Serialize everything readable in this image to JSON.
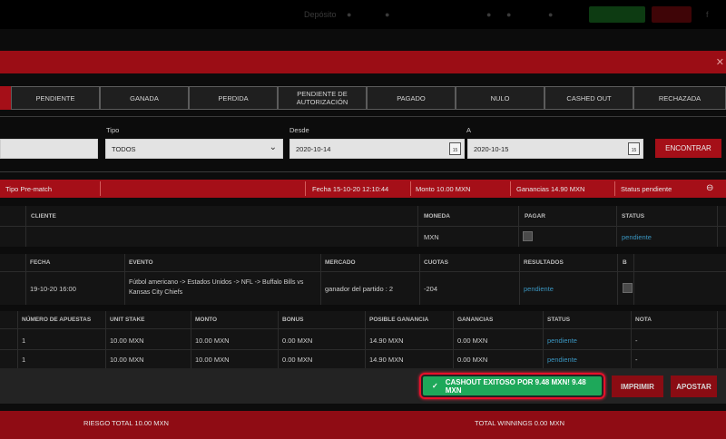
{
  "topbar": {
    "menu_label": "Depósito"
  },
  "tabs": [
    {
      "label": ""
    },
    {
      "label": "PENDIENTE"
    },
    {
      "label": "GANADA"
    },
    {
      "label": "PERDIDA"
    },
    {
      "label": "PENDIENTE DE AUTORIZACIÓN"
    },
    {
      "label": "PAGADO"
    },
    {
      "label": "NULO"
    },
    {
      "label": "CASHED OUT"
    },
    {
      "label": "RECHAZADA"
    }
  ],
  "filters": {
    "tipo_label": "Tipo",
    "tipo_value": "TODOS",
    "desde_label": "Desde",
    "desde_value": "2020-10-14",
    "a_label": "A",
    "a_value": "2020-10-15",
    "cal_day": "15",
    "find_label": "ENCONTRAR"
  },
  "ticket": {
    "tipo": "Tipo  Pre-match",
    "fecha": "Fecha  15-10-20 12:10:44",
    "monto": "Monto  10.00 MXN",
    "ganancias": "Ganancias  14.90 MXN",
    "status": "Status   pendiente"
  },
  "client_table": {
    "headers": [
      "CLIENTE",
      "MONEDA",
      "PAGAR",
      "STATUS"
    ],
    "row": {
      "moneda": "MXN",
      "status": "pendiente"
    }
  },
  "event_table": {
    "headers": [
      "FECHA",
      "EVENTO",
      "MERCADO",
      "CUOTAS",
      "RESULTADOS",
      "B"
    ],
    "row": {
      "fecha": "19-10-20 16:00",
      "evento_line1": "Fútbol americano -> Estados Unidos -> NFL -> Buffalo Bills vs",
      "evento_line2": "Kansas City Chiefs",
      "mercado": "ganador del partido : 2",
      "cuotas": "-204",
      "resultados": "pendiente"
    }
  },
  "bets_table": {
    "headers": [
      "NÚMERO DE APUESTAS",
      "UNIT STAKE",
      "MONTO",
      "BONUS",
      "POSIBLE GANANCIA",
      "GANANCIAS",
      "STATUS",
      "NOTA"
    ],
    "rows": [
      {
        "num": "1",
        "unit": "10.00 MXN",
        "monto": "10.00 MXN",
        "bonus": "0.00 MXN",
        "posible": "14.90 MXN",
        "ganancias": "0.00 MXN",
        "status": "pendiente",
        "nota": "-"
      },
      {
        "num": "1",
        "unit": "10.00 MXN",
        "monto": "10.00 MXN",
        "bonus": "0.00 MXN",
        "posible": "14.90 MXN",
        "ganancias": "0.00 MXN",
        "status": "pendiente",
        "nota": "-"
      }
    ]
  },
  "toast": {
    "message": "CASHOUT EXITOSO POR 9.48 MXN! 9.48 MXN",
    "check": "✓"
  },
  "actions": {
    "print_label": "IMPRIMIR",
    "bet_label": "APOSTAR"
  },
  "footer": {
    "riesgo": "RIESGO TOTAL  10.00 MXN",
    "winnings": "TOTAL WINNINGS  0.00 MXN"
  },
  "colors": {
    "brand_red": "#a50f18",
    "success_green": "#1ea85a",
    "link_blue": "#3a95c0"
  }
}
